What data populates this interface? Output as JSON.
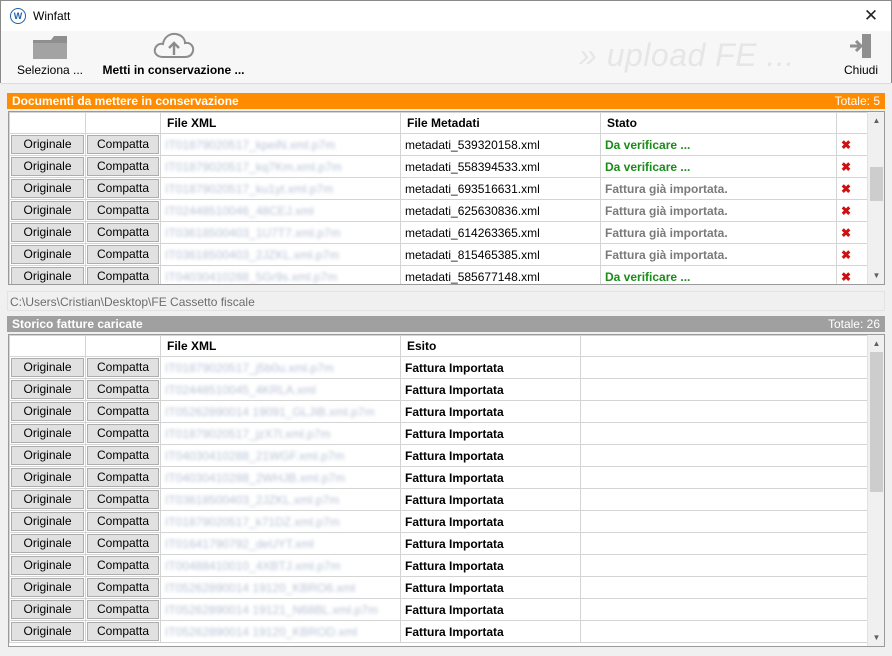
{
  "window": {
    "title": "Winfatt",
    "app_icon_letter": "W"
  },
  "toolbar": {
    "select_label": "Seleziona ...",
    "conserve_label": "Metti in conservazione ...",
    "watermark": "» upload FE ...",
    "close_label": "Chiudi"
  },
  "pending": {
    "title": "Documenti da mettere in conservazione",
    "total": "Totale: 5",
    "columns": [
      "",
      "",
      "File XML",
      "File Metadati",
      "Stato",
      ""
    ],
    "btn_original": "Originale",
    "btn_compact": "Compatta",
    "rows": [
      {
        "xml": "IT01879020517_kpeiN.xml.p7m",
        "meta": "metadati_539320158.xml",
        "stato": "Da verificare ...",
        "kind": "green"
      },
      {
        "xml": "IT01879020517_kq7Km.xml.p7m",
        "meta": "metadati_558394533.xml",
        "stato": "Da verificare ...",
        "kind": "green"
      },
      {
        "xml": "IT01879020517_ku1yt.xml.p7m",
        "meta": "metadati_693516631.xml",
        "stato": "Fattura già importata.",
        "kind": "gray"
      },
      {
        "xml": "IT02448510046_48CEJ.xml",
        "meta": "metadati_625630836.xml",
        "stato": "Fattura già importata.",
        "kind": "gray"
      },
      {
        "xml": "IT03618500403_1U7T7.xml.p7m",
        "meta": "metadati_614263365.xml",
        "stato": "Fattura già importata.",
        "kind": "gray"
      },
      {
        "xml": "IT03618500403_2JZKL.xml.p7m",
        "meta": "metadati_815465385.xml",
        "stato": "Fattura già importata.",
        "kind": "gray"
      },
      {
        "xml": "IT04030410288_5Gr9s.xml.p7m",
        "meta": "metadati_585677148.xml",
        "stato": "Da verificare ...",
        "kind": "green"
      }
    ]
  },
  "path": "C:\\Users\\Cristian\\Desktop\\FE Cassetto fiscale",
  "history": {
    "title": "Storico fatture caricate",
    "total": "Totale: 26",
    "columns": [
      "",
      "",
      "File XML",
      "Esito",
      ""
    ],
    "btn_original": "Originale",
    "btn_compact": "Compatta",
    "rows": [
      {
        "xml": "IT01879020517_j5b0u.xml.p7m",
        "esito": "Fattura Importata"
      },
      {
        "xml": "IT02448510045_4KRLA.xml",
        "esito": "Fattura Importata"
      },
      {
        "xml": "IT05262890014 19091_GLJIB.xml.p7m",
        "esito": "Fattura Importata"
      },
      {
        "xml": "IT01879020517_jzX7l.xml.p7m",
        "esito": "Fattura Importata"
      },
      {
        "xml": "IT04030410288_21WGF.xml.p7m",
        "esito": "Fattura Importata"
      },
      {
        "xml": "IT04030410288_2WHJB.xml.p7m",
        "esito": "Fattura Importata"
      },
      {
        "xml": "IT03618500403_2JZKL.xml.p7m",
        "esito": "Fattura Importata"
      },
      {
        "xml": "IT01879020517_k71DZ.xml.p7m",
        "esito": "Fattura Importata"
      },
      {
        "xml": "IT01641790792_deUYT.xml",
        "esito": "Fattura Importata"
      },
      {
        "xml": "IT00488410010_4XBTJ.xml.p7m",
        "esito": "Fattura Importata"
      },
      {
        "xml": "IT05262890014 19120_KBRO6.xml",
        "esito": "Fattura Importata"
      },
      {
        "xml": "IT05262890014 19121_N68BL.xml.p7m",
        "esito": "Fattura Importata"
      },
      {
        "xml": "IT05262890014 19120_KBROD.xml",
        "esito": "Fattura Importata"
      }
    ]
  },
  "colors": {
    "accent_orange": "#ff8c00",
    "status_green": "#1a8c1a",
    "status_gray": "#7a7a7a",
    "delete_red": "#cc1111"
  },
  "icons": {
    "select": "folder-icon",
    "conserve": "cloud-upload-icon",
    "close": "exit-door-icon",
    "delete": "delete-x-icon"
  }
}
